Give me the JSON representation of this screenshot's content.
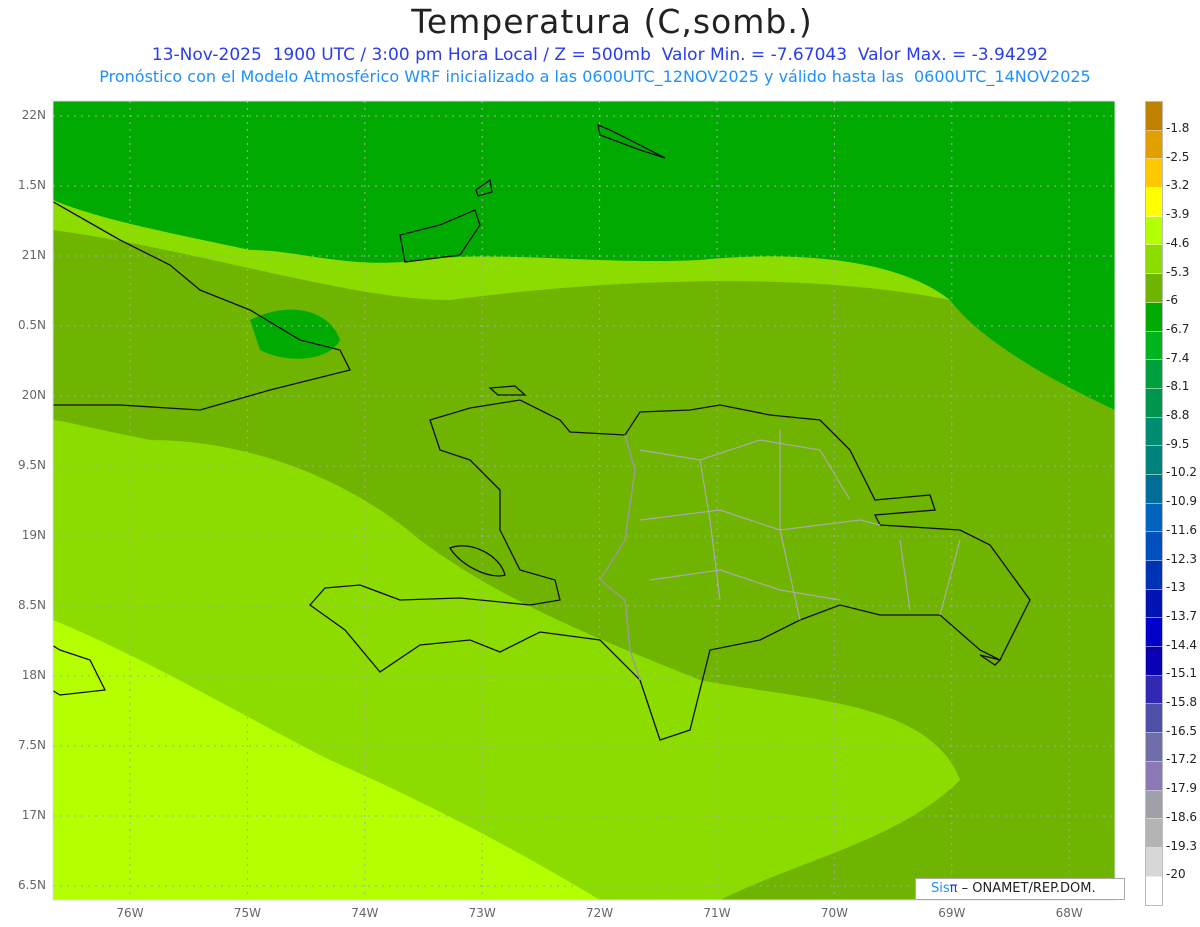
{
  "header": {
    "title": "Temperatura (C,somb.)",
    "line1": "13-Nov-2025  1900 UTC / 3:00 pm Hora Local / Z = 500mb  Valor Min. = -7.67043  Valor Max. = -3.94292",
    "line2": "Pronóstico con el Modelo Atmosférico WRF inicializado a las 0600UTC_12NOV2025 y válido hasta las  0600UTC_14NOV2025"
  },
  "axes": {
    "lat_labels": [
      "22N",
      "1.5N",
      "21N",
      "0.5N",
      "20N",
      "9.5N",
      "19N",
      "8.5N",
      "18N",
      "7.5N",
      "17N",
      "6.5N"
    ],
    "lon_labels": [
      "76W",
      "75W",
      "74W",
      "73W",
      "72W",
      "71W",
      "70W",
      "69W",
      "68W"
    ]
  },
  "colorbar": {
    "colors": [
      "#c08000",
      "#e0a000",
      "#ffc800",
      "#ffff00",
      "#b4ff00",
      "#8cdc00",
      "#6eb400",
      "#00aa00",
      "#00b41e",
      "#00a03c",
      "#009650",
      "#008c6e",
      "#00827d",
      "#006e96",
      "#0064be",
      "#0050be",
      "#0032b4",
      "#0014b4",
      "#0000c8",
      "#0a00b4",
      "#3228b4",
      "#5050aa",
      "#6e6eaa",
      "#8c78b4",
      "#a0a0aa",
      "#b4b4b4",
      "#d7d7d7",
      "#ffffff"
    ],
    "labels": [
      "-1.8",
      "-2.5",
      "-3.2",
      "-3.9",
      "-4.6",
      "-5.3",
      "-6",
      "-6.7",
      "-7.4",
      "-8.1",
      "-8.8",
      "-9.5",
      "-10.2",
      "-10.9",
      "-11.6",
      "-12.3",
      "-13",
      "-13.7",
      "-14.4",
      "-15.1",
      "-15.8",
      "-16.5",
      "-17.2",
      "-17.9",
      "-18.6",
      "-19.3",
      "-20"
    ]
  },
  "credit": {
    "sis": "Sis",
    "pi": "π",
    "org": " – ONAMET/REP.DOM."
  }
}
